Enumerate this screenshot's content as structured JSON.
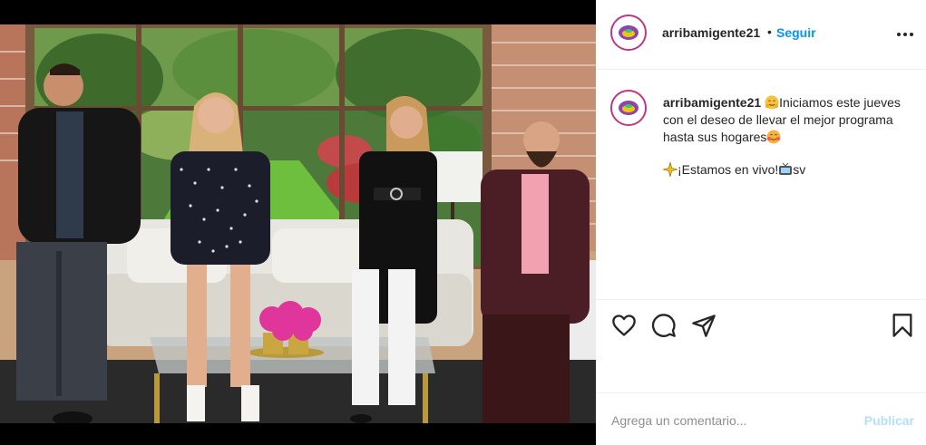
{
  "header": {
    "username": "arribamigente21",
    "separator": "•",
    "follow_label": "Seguir",
    "more_icon": "more-horizontal-icon"
  },
  "caption": {
    "username": "arribamigente21",
    "line1_text": "Iniciamos este jueves con el deseo de llevar el mejor programa hasta sus hogares",
    "line2_text": "¡Estamos en vivo!",
    "line2_suffix": "sv",
    "emojis": [
      "hugging-face-emoji",
      "smiling-face-with-hearts-emoji",
      "sparkle-emoji",
      "tv-emoji"
    ]
  },
  "actions": {
    "icons": [
      "heart-icon",
      "comment-icon",
      "share-icon",
      "bookmark-icon"
    ]
  },
  "comment": {
    "placeholder": "Agrega un comentario...",
    "publish_label": "Publicar"
  },
  "colors": {
    "accent": "#0095f6",
    "publish_disabled": "#b2dffc",
    "text": "#262626",
    "muted": "#8e8e8e",
    "divider": "#efefef",
    "avatar_ring": "#c13584"
  }
}
